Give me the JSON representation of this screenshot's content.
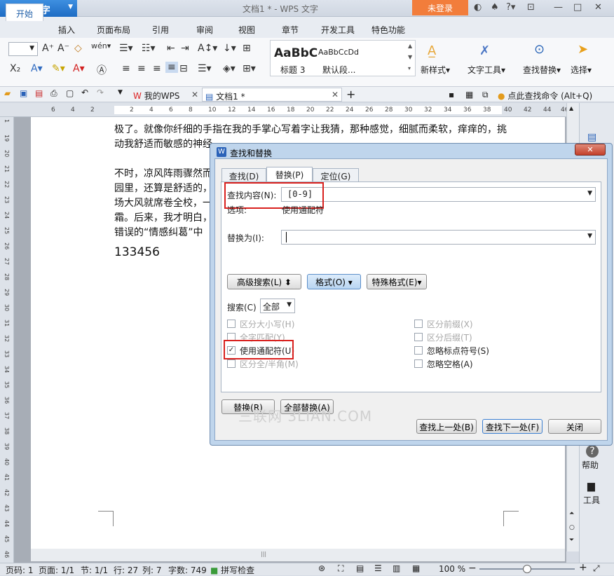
{
  "app": {
    "name": "WPS 文字",
    "doc_title": "文档1 * - WPS 文字",
    "login": "未登录"
  },
  "ribbon_tabs": [
    "开始",
    "插入",
    "页面布局",
    "引用",
    "审阅",
    "视图",
    "章节",
    "开发工具",
    "特色功能"
  ],
  "styles": {
    "sample1": "AaBbC",
    "sample2": "AaBbCcDd",
    "label1": "标题 3",
    "label2": "默认段..."
  },
  "ribbon_buttons": {
    "new_style": "新样式",
    "text_tools": "文字工具",
    "find_replace": "查找替换",
    "select": "选择"
  },
  "doc_tabs": {
    "wps": "我的WPS",
    "doc1": "文档1 *",
    "search_cmd": "点此查找命令 (Alt+Q)"
  },
  "ruler": {
    "h": [
      "6",
      "4",
      "2",
      "2",
      "4",
      "6",
      "8",
      "10",
      "12",
      "14",
      "16",
      "18",
      "20",
      "22",
      "24",
      "26",
      "28",
      "30",
      "32",
      "34",
      "36",
      "38",
      "40",
      "42",
      "44",
      "46"
    ],
    "v": [
      "1",
      "19",
      "20",
      "21",
      "22",
      "23",
      "24",
      "25",
      "26",
      "27",
      "28",
      "29",
      "30",
      "31",
      "32",
      "33",
      "34",
      "35",
      "36",
      "37",
      "38",
      "39",
      "40",
      "41",
      "42",
      "43",
      "44",
      "45",
      "46"
    ]
  },
  "document": {
    "line1": "极了。就像你纤细的手指在我的手掌心写着字让我猜，那种感觉，细腻而柔软，痒痒的，挑",
    "line2": "动我舒适而敏感的神经",
    "line3": "不时，凉风阵雨骤然而",
    "line4": "园里，还算是舒适的，",
    "line5": "场大风就席卷全校，一",
    "line6": "霜。后来，我才明白，",
    "line7": "错误的“情感纠葛”中",
    "number": "133456"
  },
  "dialog": {
    "title": "查找和替换",
    "close": "✕",
    "tabs": [
      "查找(D)",
      "替换(P)",
      "定位(G)"
    ],
    "find_label": "查找内容(N):",
    "find_value": "[0-9]",
    "options_label": "选项:",
    "options_value": "使用通配符",
    "replace_label": "替换为(I):",
    "replace_value": "",
    "advanced": "高级搜索(L)",
    "format": "格式(O)",
    "special": "特殊格式(E)",
    "search_label": "搜索(C)",
    "search_value": "全部",
    "checkboxes_left": [
      {
        "label": "区分大小写(H)",
        "checked": false,
        "disabled": true
      },
      {
        "label": "全字匹配(Y)",
        "checked": false,
        "disabled": true
      },
      {
        "label": "使用通配符(U)",
        "checked": true,
        "disabled": false
      },
      {
        "label": "区分全/半角(M)",
        "checked": false,
        "disabled": true
      }
    ],
    "checkboxes_right": [
      {
        "label": "区分前缀(X)",
        "checked": false,
        "disabled": true
      },
      {
        "label": "区分后缀(T)",
        "checked": false,
        "disabled": true
      },
      {
        "label": "忽略标点符号(S)",
        "checked": false,
        "disabled": false
      },
      {
        "label": "忽略空格(A)",
        "checked": false,
        "disabled": false
      }
    ],
    "replace_btn": "替换(R)",
    "replace_all_btn": "全部替换(A)",
    "find_prev": "查找上一处(B)",
    "find_next": "查找下一处(F)",
    "close_btn": "关闭"
  },
  "watermark": "三联网 3LIAN.COM",
  "right_panel": {
    "help": "帮助",
    "tools": "工具"
  },
  "status": {
    "page": "页码: 1",
    "pages": "页面: 1/1",
    "section": "节: 1/1",
    "row": "行: 27",
    "col": "列: 7",
    "words": "字数: 749",
    "spell": "拼写检查",
    "zoom": "100 %"
  }
}
